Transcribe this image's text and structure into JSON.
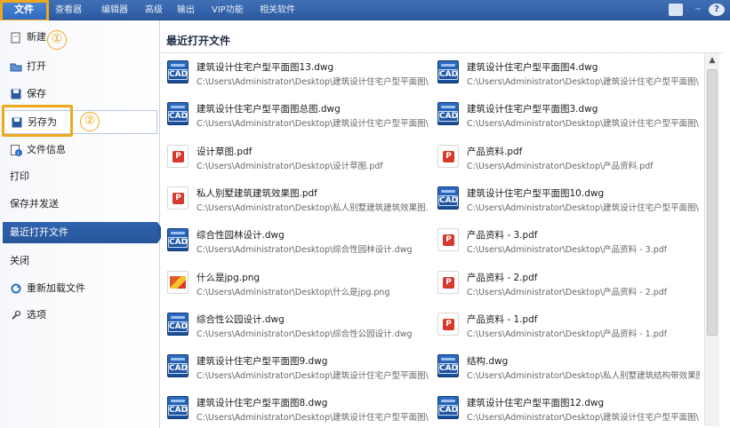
{
  "ribbon": {
    "file_tab": "文件",
    "tabs": [
      "查看器",
      "编辑器",
      "高级",
      "输出",
      "VIP功能",
      "相关软件"
    ]
  },
  "sidebar": {
    "items": [
      {
        "label": "新建",
        "icon": "new-file-icon"
      },
      {
        "label": "打开",
        "icon": "open-folder-icon"
      },
      {
        "label": "保存",
        "icon": "save-icon"
      },
      {
        "label": "另存为",
        "icon": "save-as-icon"
      },
      {
        "label": "文件信息",
        "icon": "info-icon"
      },
      {
        "label": "打印",
        "icon": ""
      },
      {
        "label": "保存并发送",
        "icon": ""
      },
      {
        "label": "最近打开文件",
        "icon": ""
      },
      {
        "label": "关闭",
        "icon": ""
      },
      {
        "label": "重新加载文件",
        "icon": "reload-icon"
      },
      {
        "label": "选项",
        "icon": "options-icon"
      }
    ],
    "selected": "最近打开文件"
  },
  "annotations": {
    "step1": "①",
    "step2": "②"
  },
  "colors": {
    "ribbon_blue": "#2c5aa0",
    "highlight_orange": "#f0a81c",
    "selected_nav": "#26569b"
  },
  "main": {
    "title": "最近打开文件",
    "files": [
      {
        "name": "建筑设计住宅户型平面图13.dwg",
        "path": "C:\\Users\\Administrator\\Desktop\\建筑设计住宅户型平面图\\",
        "type": "cad"
      },
      {
        "name": "建筑设计住宅户型平面图4.dwg",
        "path": "C:\\Users\\Administrator\\Desktop\\建筑设计住宅户型平面图\\",
        "type": "cad"
      },
      {
        "name": "建筑设计住宅户型平面图总图.dwg",
        "path": "C:\\Users\\Administrator\\Desktop\\建筑设计住宅户型平面图\\",
        "type": "cad"
      },
      {
        "name": "建筑设计住宅户型平面图3.dwg",
        "path": "C:\\Users\\Administrator\\Desktop\\建筑设计住宅户型平面图\\",
        "type": "cad"
      },
      {
        "name": "设计草图.pdf",
        "path": "C:\\Users\\Administrator\\Desktop\\设计草图.pdf",
        "type": "pdf"
      },
      {
        "name": "产品资料.pdf",
        "path": "C:\\Users\\Administrator\\Desktop\\产品资料.pdf",
        "type": "pdf"
      },
      {
        "name": "私人别墅建筑建筑效果图.pdf",
        "path": "C:\\Users\\Administrator\\Desktop\\私人别墅建筑建筑效果图.",
        "type": "pdf"
      },
      {
        "name": "建筑设计住宅户型平面图10.dwg",
        "path": "C:\\Users\\Administrator\\Desktop\\建筑设计住宅户型平面图\\",
        "type": "cad"
      },
      {
        "name": "综合性园林设计.dwg",
        "path": "C:\\Users\\Administrator\\Desktop\\综合性园林设计.dwg",
        "type": "cad"
      },
      {
        "name": "产品资料 - 3.pdf",
        "path": "C:\\Users\\Administrator\\Desktop\\产品资料 - 3.pdf",
        "type": "pdf"
      },
      {
        "name": "什么是jpg.png",
        "path": "C:\\Users\\Administrator\\Desktop\\什么是jpg.png",
        "type": "png"
      },
      {
        "name": "产品资料 - 2.pdf",
        "path": "C:\\Users\\Administrator\\Desktop\\产品资料 - 2.pdf",
        "type": "pdf"
      },
      {
        "name": "综合性公园设计.dwg",
        "path": "C:\\Users\\Administrator\\Desktop\\综合性公园设计.dwg",
        "type": "cad"
      },
      {
        "name": "产品资料 - 1.pdf",
        "path": "C:\\Users\\Administrator\\Desktop\\产品资料 - 1.pdf",
        "type": "pdf"
      },
      {
        "name": "建筑设计住宅户型平面图9.dwg",
        "path": "C:\\Users\\Administrator\\Desktop\\建筑设计住宅户型平面图\\",
        "type": "cad"
      },
      {
        "name": "结构.dwg",
        "path": "C:\\Users\\Administrator\\Desktop\\私人别墅建筑结构带效果图",
        "type": "cad"
      },
      {
        "name": "建筑设计住宅户型平面图8.dwg",
        "path": "C:\\Users\\Administrator\\Desktop\\建筑设计住宅户型平面图\\",
        "type": "cad"
      },
      {
        "name": "建筑设计住宅户型平面图12.dwg",
        "path": "C:\\Users\\Administrator\\Desktop\\建筑设计住宅户型平面图\\",
        "type": "cad"
      }
    ]
  }
}
